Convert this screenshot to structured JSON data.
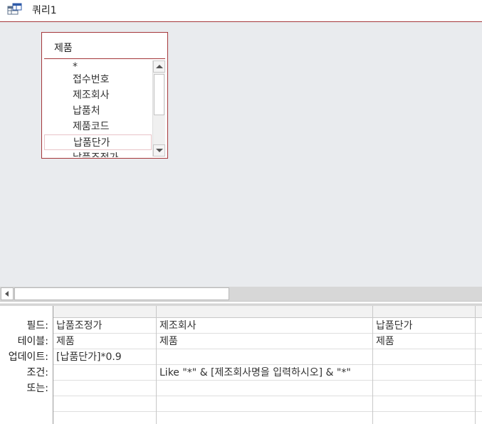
{
  "window": {
    "title": "쿼리1",
    "icon": "query-icon"
  },
  "table": {
    "name": "제품",
    "fields": [
      "*",
      "접수번호",
      "제조회사",
      "납품처",
      "제품코드",
      "납품단가",
      "납품조정가"
    ],
    "selected_field": "납품단가"
  },
  "grid": {
    "row_labels": [
      "필드:",
      "테이블:",
      "업데이트:",
      "조건:",
      "또는:"
    ],
    "columns": [
      {
        "field": "납품조정가",
        "table": "제품",
        "update": "[납품단가]*0.9",
        "criteria": "",
        "or": ""
      },
      {
        "field": "제조회사",
        "table": "제품",
        "update": "",
        "criteria": "Like \"*\" & [제조회사명을 입력하시오] & \"*\"",
        "or": ""
      },
      {
        "field": "납품단가",
        "table": "제품",
        "update": "",
        "criteria": "",
        "or": ""
      },
      {
        "field": "",
        "table": "",
        "update": "",
        "criteria": "",
        "or": ""
      }
    ]
  },
  "colors": {
    "accent": "#a4373a",
    "design_background": "#e9ebee"
  }
}
